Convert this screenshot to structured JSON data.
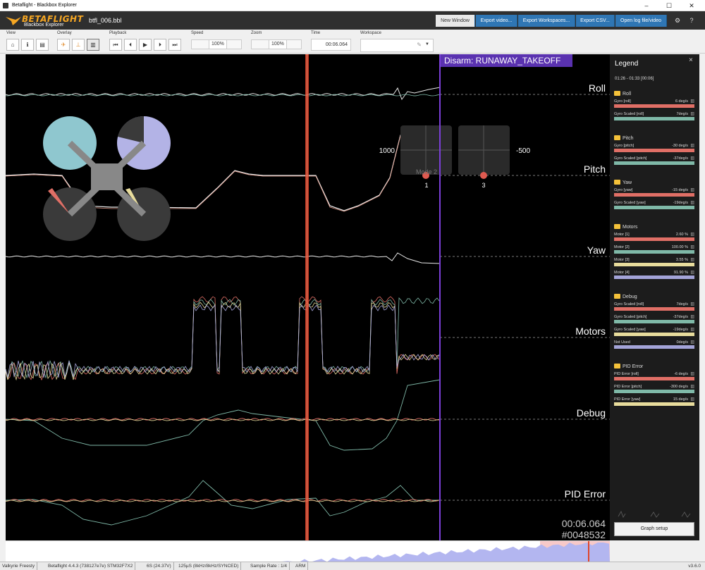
{
  "window": {
    "title": "Betaflight - Blackbox Explorer",
    "minimize": "–",
    "maximize": "☐",
    "close": "✕"
  },
  "header": {
    "brand": "BETAFLIGHT",
    "subtitle": "Blackbox Explorer",
    "filename": "btfl_006.bbl",
    "buttons": {
      "new_window": "New Window",
      "export_video": "Export video...",
      "export_workspaces": "Export Workspaces...",
      "export_csv": "Export CSV...",
      "open_log": "Open log file/video"
    },
    "settings_icon": "gear-icon",
    "help_icon": "question-icon",
    "settings_glyph": "⚙",
    "help_glyph": "?"
  },
  "toolbar": {
    "view_label": "View",
    "overlay_label": "Overlay",
    "playback_label": "Playback",
    "speed_label": "Speed",
    "zoom_label": "Zoom",
    "time_label": "Time",
    "workspace_label": "Workspace",
    "speed_value": "100%",
    "zoom_value": "100%",
    "time_value": "00:06.064",
    "view_icons": [
      "⌂",
      "ℹ",
      "▤"
    ],
    "overlay_icons": [
      "✈",
      "⊥",
      "▥"
    ],
    "playback_icons": [
      "⏮",
      "⏴",
      "▶",
      "⏵",
      "⏭"
    ]
  },
  "graph": {
    "disarm_label": "Disarm: RUNAWAY_TAKEOFF",
    "groups": [
      "Roll",
      "Pitch",
      "Yaw",
      "Motors",
      "Debug",
      "PID Error"
    ],
    "stick_left_value": "1000",
    "stick_right_value": "-500",
    "mode_label": "Mode 2",
    "stick_left_num": "1",
    "stick_right_num": "3",
    "time_readout": "00:06.064",
    "frame_readout": "#0048532"
  },
  "legend": {
    "title": "Legend",
    "close": "×",
    "range": "01:26 - 01:33 [00:06]",
    "groups": [
      {
        "name": "Roll",
        "items": [
          {
            "name": "Gyro [roll]",
            "value": "6 deg/s",
            "color": "#e06f66"
          },
          {
            "name": "Gyro Scaled [roll]",
            "value": "7deg/s",
            "color": "#7fb9a8"
          }
        ]
      },
      {
        "name": "Pitch",
        "items": [
          {
            "name": "Gyro [pitch]",
            "value": "-30 deg/s",
            "color": "#e06f66"
          },
          {
            "name": "Gyro Scaled [pitch]",
            "value": "-37deg/s",
            "color": "#7fb9a8"
          }
        ]
      },
      {
        "name": "Yaw",
        "items": [
          {
            "name": "Gyro [yaw]",
            "value": "-15 deg/s",
            "color": "#e06f66"
          },
          {
            "name": "Gyro Scaled [yaw]",
            "value": "-19deg/s",
            "color": "#7fb9a8"
          }
        ]
      },
      {
        "name": "Motors",
        "items": [
          {
            "name": "Motor [1]",
            "value": "2.60 %",
            "color": "#e06f66"
          },
          {
            "name": "Motor [2]",
            "value": "100.00 %",
            "color": "#7fb9a8"
          },
          {
            "name": "Motor [3]",
            "value": "3.55 %",
            "color": "#e8dc9c"
          },
          {
            "name": "Motor [4]",
            "value": "91.90 %",
            "color": "#a4a4d8"
          }
        ]
      },
      {
        "name": "Debug",
        "items": [
          {
            "name": "Gyro Scaled [roll]",
            "value": "7deg/s",
            "color": "#e06f66"
          },
          {
            "name": "Gyro Scaled [pitch]",
            "value": "-37deg/s",
            "color": "#7fb9a8"
          },
          {
            "name": "Gyro Scaled [yaw]",
            "value": "-19deg/s",
            "color": "#e8dc9c"
          },
          {
            "name": "Not Used",
            "value": "0deg/s",
            "color": "#a4a4d8"
          }
        ]
      },
      {
        "name": "PID Error",
        "items": [
          {
            "name": "PID Error [roll]",
            "value": "-6 deg/s",
            "color": "#e06f66"
          },
          {
            "name": "PID Error [pitch]",
            "value": "-300 deg/s",
            "color": "#7fb9a8"
          },
          {
            "name": "PID Error [yaw]",
            "value": "15 deg/s",
            "color": "#e8dc9c"
          }
        ]
      }
    ],
    "graph_setup": "Graph setup"
  },
  "status": {
    "craft": "Valkyrie Freesty",
    "firmware": "Betaflight 4.4.3 (738127e7e) STM32F7X2",
    "battery": "6S (24.37V)",
    "looptime": "125µS (8kHz/8kHz/SYNCED)",
    "sample_rate": "Sample Rate : 1/4",
    "state": "ARM",
    "version": "v3.6.0"
  },
  "colors": {
    "accent": "#2f76b4",
    "brand": "#f5a623",
    "disarm": "#7b3fd8",
    "cursor": "#e0452a"
  }
}
